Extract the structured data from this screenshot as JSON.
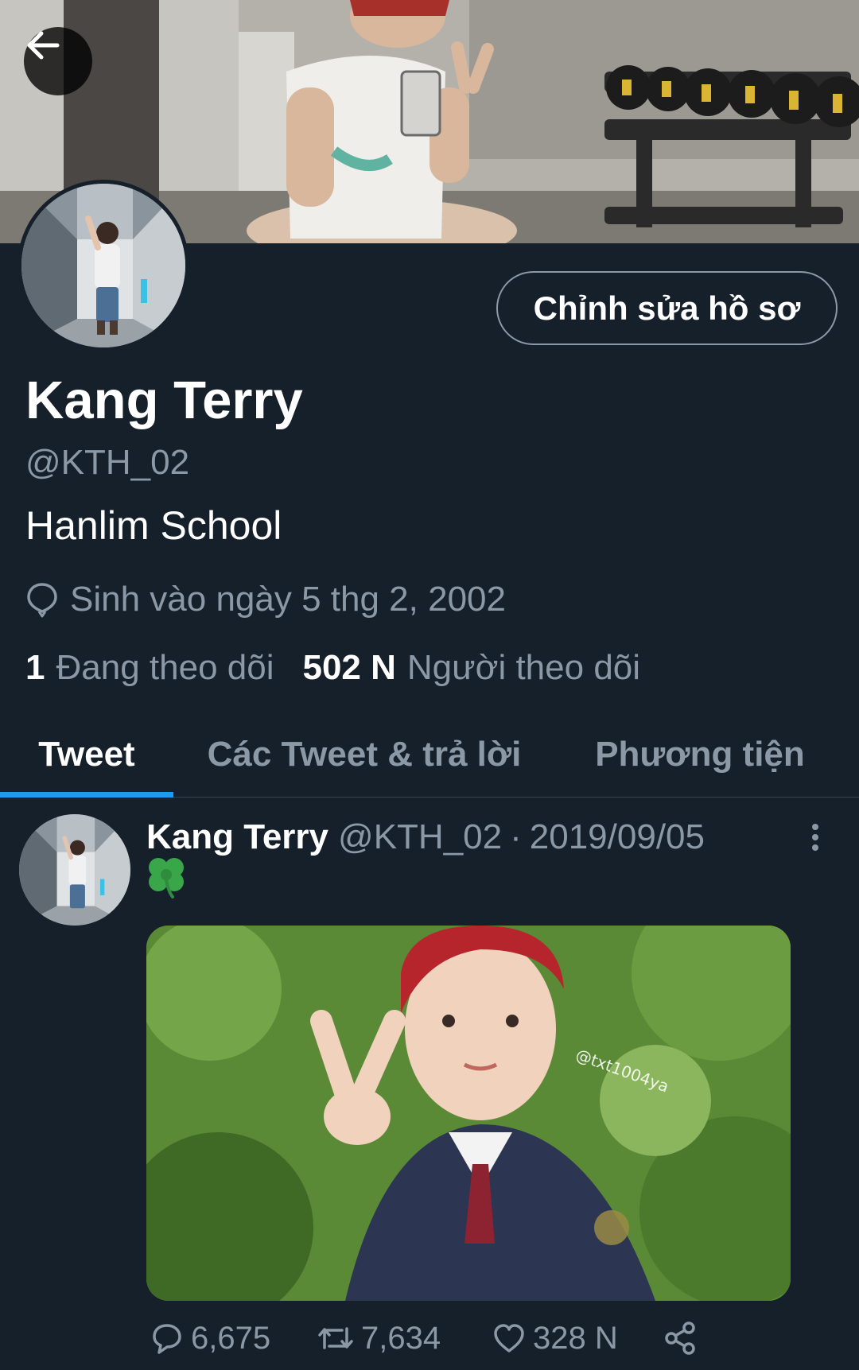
{
  "header": {
    "back_icon": "arrow-left-icon"
  },
  "profile": {
    "display_name": "Kang Terry",
    "handle": "@KTH_02",
    "bio": "Hanlim School",
    "birth_icon": "balloon-icon",
    "birth_text": "Sinh vào ngày 5 thg 2, 2002",
    "following_count": "1",
    "following_label": "Đang theo dõi",
    "followers_count": "502 N",
    "followers_label": "Người theo dõi",
    "edit_button_label": "Chỉnh sửa hồ sơ"
  },
  "tabs": [
    {
      "label": "Tweet",
      "active": true
    },
    {
      "label": "Các Tweet & trả lời",
      "active": false
    },
    {
      "label": "Phương tiện",
      "active": false
    }
  ],
  "tweet": {
    "author_name": "Kang Terry",
    "author_handle": "@KTH_02",
    "separator": "·",
    "date": "2019/09/05",
    "text": "🍀",
    "media_watermark": "@txt1004ya",
    "actions": {
      "reply_count": "6,675",
      "retweet_count": "7,634",
      "like_count": "328 N",
      "share_icon": "share-icon"
    }
  },
  "colors": {
    "background": "#15202b",
    "secondary_text": "#8b98a5",
    "accent": "#1d9bf0",
    "border": "#38444d"
  }
}
